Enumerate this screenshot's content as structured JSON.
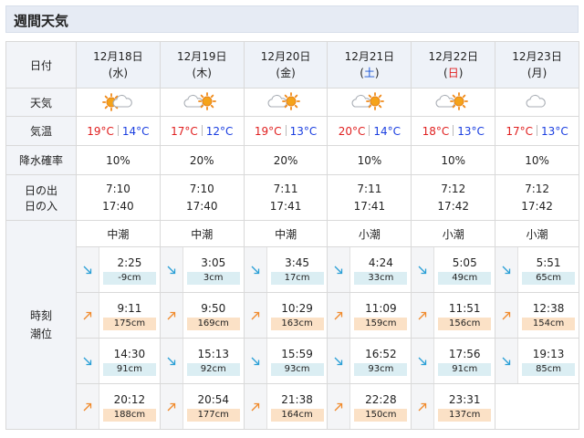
{
  "title": "週間天気",
  "labels": {
    "date": "日付",
    "weather": "天気",
    "temp": "気温",
    "rain": "降水確率",
    "sunrise": "日の出",
    "sunset": "日の入",
    "tide_time": "時刻",
    "tide_level": "潮位"
  },
  "temp_unit_sep": "|",
  "days": [
    {
      "date": "12月18日",
      "dow": "(水)",
      "dow_type": "weekday",
      "weather_icon": "sun-cloud-icon",
      "temp_hi": "19°C",
      "temp_lo": "14°C",
      "rain": "10%",
      "sunrise": "7:10",
      "sunset": "17:40",
      "tide_type": "中潮",
      "tides": [
        {
          "dir": "down",
          "time": "2:25",
          "level": "-9cm"
        },
        {
          "dir": "up",
          "time": "9:11",
          "level": "175cm"
        },
        {
          "dir": "down",
          "time": "14:30",
          "level": "91cm"
        },
        {
          "dir": "up",
          "time": "20:12",
          "level": "188cm"
        }
      ]
    },
    {
      "date": "12月19日",
      "dow": "(木)",
      "dow_type": "weekday",
      "weather_icon": "cloud-sun-icon",
      "temp_hi": "17°C",
      "temp_lo": "12°C",
      "rain": "20%",
      "sunrise": "7:10",
      "sunset": "17:40",
      "tide_type": "中潮",
      "tides": [
        {
          "dir": "down",
          "time": "3:05",
          "level": "3cm"
        },
        {
          "dir": "up",
          "time": "9:50",
          "level": "169cm"
        },
        {
          "dir": "down",
          "time": "15:13",
          "level": "92cm"
        },
        {
          "dir": "up",
          "time": "20:54",
          "level": "177cm"
        }
      ]
    },
    {
      "date": "12月20日",
      "dow": "(金)",
      "dow_type": "weekday",
      "weather_icon": "cloud-sun-icon",
      "temp_hi": "19°C",
      "temp_lo": "13°C",
      "rain": "20%",
      "sunrise": "7:11",
      "sunset": "17:41",
      "tide_type": "中潮",
      "tides": [
        {
          "dir": "down",
          "time": "3:45",
          "level": "17cm"
        },
        {
          "dir": "up",
          "time": "10:29",
          "level": "163cm"
        },
        {
          "dir": "down",
          "time": "15:59",
          "level": "93cm"
        },
        {
          "dir": "up",
          "time": "21:38",
          "level": "164cm"
        }
      ]
    },
    {
      "date": "12月21日",
      "dow": "(土)",
      "dow_type": "saturday",
      "weather_icon": "cloud-sun-icon",
      "temp_hi": "20°C",
      "temp_lo": "14°C",
      "rain": "10%",
      "sunrise": "7:11",
      "sunset": "17:41",
      "tide_type": "小潮",
      "tides": [
        {
          "dir": "down",
          "time": "4:24",
          "level": "33cm"
        },
        {
          "dir": "up",
          "time": "11:09",
          "level": "159cm"
        },
        {
          "dir": "down",
          "time": "16:52",
          "level": "93cm"
        },
        {
          "dir": "up",
          "time": "22:28",
          "level": "150cm"
        }
      ]
    },
    {
      "date": "12月22日",
      "dow": "(日)",
      "dow_type": "sunday",
      "weather_icon": "cloud-sun-icon",
      "temp_hi": "18°C",
      "temp_lo": "13°C",
      "rain": "10%",
      "sunrise": "7:12",
      "sunset": "17:42",
      "tide_type": "小潮",
      "tides": [
        {
          "dir": "down",
          "time": "5:05",
          "level": "49cm"
        },
        {
          "dir": "up",
          "time": "11:51",
          "level": "156cm"
        },
        {
          "dir": "down",
          "time": "17:56",
          "level": "91cm"
        },
        {
          "dir": "up",
          "time": "23:31",
          "level": "137cm"
        }
      ]
    },
    {
      "date": "12月23日",
      "dow": "(月)",
      "dow_type": "weekday",
      "weather_icon": "cloud-icon",
      "temp_hi": "17°C",
      "temp_lo": "13°C",
      "rain": "10%",
      "sunrise": "7:12",
      "sunset": "17:42",
      "tide_type": "小潮",
      "tides": [
        {
          "dir": "down",
          "time": "5:51",
          "level": "65cm"
        },
        {
          "dir": "up",
          "time": "12:38",
          "level": "154cm"
        },
        {
          "dir": "down",
          "time": "19:13",
          "level": "85cm"
        }
      ]
    }
  ],
  "colors": {
    "temp_high": "#e02020",
    "temp_low": "#1a3ee0",
    "saturday": "#1a55d6",
    "sunday": "#e02020",
    "arrow_down": "#2a9fd6",
    "arrow_up": "#f08a2c",
    "badge_low": "#dbeef3",
    "badge_high": "#fbe1c6"
  }
}
